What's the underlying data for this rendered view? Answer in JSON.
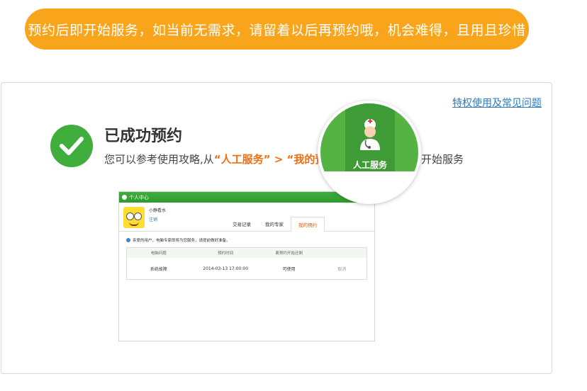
{
  "banner": {
    "text": "预约后即开始服务，如当前无需求，请留着以后再预约哦，机会难得，且用且珍惜"
  },
  "card": {
    "help_link": "特权使用及常见问题",
    "success_title": "已成功预约",
    "guide": {
      "prefix": "您可以参考使用攻略,从",
      "step1": "“人工服务”",
      "arrow": " > ",
      "step2": "“我的预约”",
      "suffix": " 中去查看预约，开始服务"
    }
  },
  "preview": {
    "topbar": "个人中心",
    "user_name": "小静看水",
    "logout": "注销",
    "tabs": [
      "交易记录",
      "我的专家",
      "我的预约"
    ],
    "notice": "亲爱的用户，电脑专家即将为您服务，请提前做好准备。",
    "table": {
      "headers": [
        "电脑问题",
        "预约时间",
        "离预约开始还剩",
        ""
      ],
      "row": [
        "系统故障",
        "2014-03-13 17:00:00",
        "可使用",
        "取消"
      ]
    }
  },
  "magnifier": {
    "label": "人工服务"
  },
  "colors": {
    "banner": "#f8a51c",
    "green": "#3fae3c",
    "highlight": "#f36c0d",
    "link": "#2a7bbf"
  },
  "icons": [
    "check-icon",
    "doctor-icon",
    "info-icon"
  ]
}
